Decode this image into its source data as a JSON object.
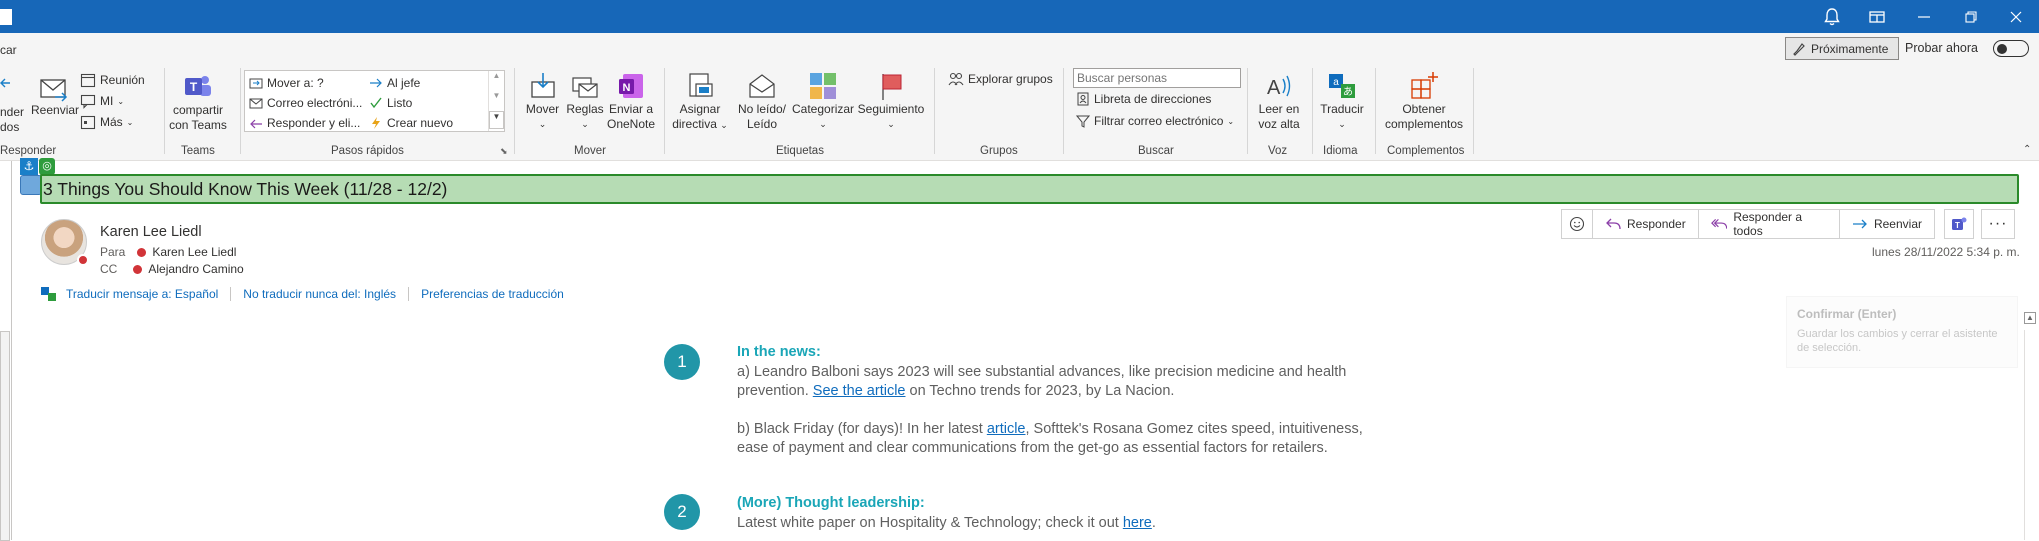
{
  "titlebar": {
    "icons": [
      "bell-icon",
      "window-icon",
      "minimize-icon",
      "restore-icon",
      "close-icon"
    ]
  },
  "search_cut": "car",
  "proximamente": "Próximamente",
  "probar_ahora": "Probar ahora",
  "ribbon": {
    "responder_group": {
      "cut_label_1": "nder",
      "cut_label_2": "dos",
      "reenviar": "Reenviar",
      "reunion": "Reunión",
      "mi": "MI",
      "mas": "Más",
      "label": "Responder"
    },
    "teams_group": {
      "button_line1": "compartir",
      "button_line2": "con Teams",
      "label": "Teams"
    },
    "quick_steps": {
      "items": [
        "Mover a: ?",
        "Correo electróni...",
        "Responder y eli...",
        "Al jefe",
        "Listo",
        "Crear nuevo"
      ],
      "label": "Pasos rápidos"
    },
    "mover_group": {
      "mover": "Mover",
      "reglas": "Reglas",
      "enviar_line1": "Enviar a",
      "enviar_line2": "OneNote",
      "label": "Mover"
    },
    "etiquetas_group": {
      "asignar_line1": "Asignar",
      "asignar_line2": "directiva",
      "noleido_line1": "No leído/",
      "noleido_line2": "Leído",
      "categorizar": "Categorizar",
      "seguimiento": "Seguimiento",
      "label": "Etiquetas"
    },
    "grupos_group": {
      "explorar": "Explorar grupos",
      "label": "Grupos"
    },
    "buscar_group": {
      "placeholder": "Buscar personas",
      "libreta": "Libreta de direcciones",
      "filtrar": "Filtrar correo electrónico",
      "label": "Buscar"
    },
    "voz_group": {
      "leer_line1": "Leer en",
      "leer_line2": "voz alta",
      "label": "Voz"
    },
    "idioma_group": {
      "traducir": "Traducir",
      "label": "Idioma"
    },
    "complementos_group": {
      "obtener_line1": "Obtener",
      "obtener_line2": "complementos",
      "label": "Complementos"
    }
  },
  "message": {
    "subject": "3 Things You Should Know This Week (11/28  - 12/2)",
    "sender": "Karen Lee Liedl",
    "to_label": "Para",
    "to_name": "Karen Lee Liedl",
    "cc_label": "CC",
    "cc_name": "Alejandro Camino",
    "date": "lunes 28/11/2022 5:34 p. m.",
    "actions": {
      "responder": "Responder",
      "responder_todos": "Responder a todos",
      "reenviar": "Reenviar"
    },
    "translate": {
      "translate_to": "Traducir mensaje a: Español",
      "never": "No traducir nunca del: Inglés",
      "prefs": "Preferencias de traducción"
    },
    "tooltip": {
      "title": "Confirmar (Enter)",
      "body": "Guardar los cambios y cerrar el asistente de selección."
    },
    "body": {
      "item1": {
        "number": "1",
        "heading": "In the news:",
        "a_prefix": "a) Leandro Balboni says 2023 will see substantial advances, like precision medicine and health",
        "a_line2_prefix": "prevention. ",
        "a_link": "See the article",
        "a_suffix": " on Techno trends for 2023, by La Nacion.",
        "b_prefix": "b) Black Friday (for days)! In her latest ",
        "b_link": "article",
        "b_suffix": ", Softtek's Rosana Gomez cites speed, intuitiveness,",
        "b_line2": "ease of payment and clear communications from the get-go as essential factors for retailers."
      },
      "item2": {
        "number": "2",
        "heading": "(More) Thought leadership:",
        "line_prefix": "Latest white paper on Hospitality & Technology; check it out ",
        "link": "here",
        "line_suffix": "."
      }
    }
  },
  "colors": {
    "titlebar": "#1767b8",
    "subject_bg": "#b6dcb4",
    "subject_border": "#2a8a2a",
    "accent_teal": "#1aa6b7",
    "link": "#0f6cbd"
  }
}
